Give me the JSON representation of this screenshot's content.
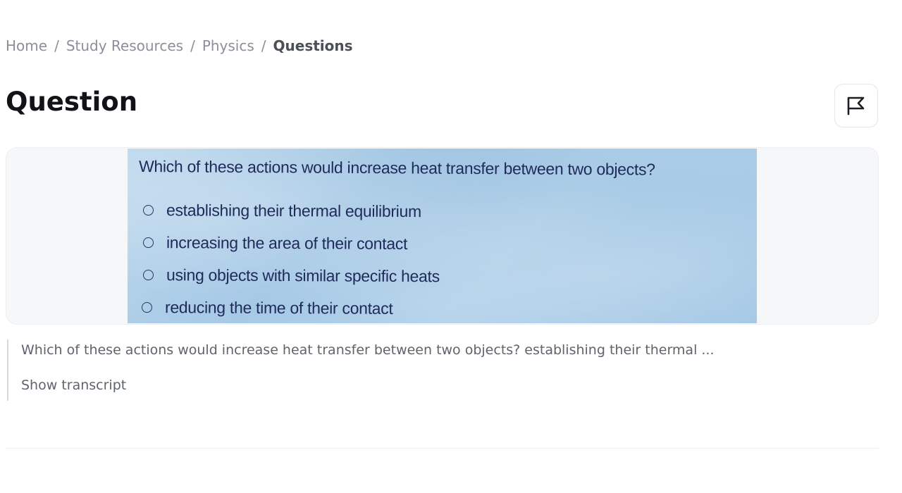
{
  "breadcrumb": {
    "items": [
      "Home",
      "Study Resources",
      "Physics"
    ],
    "current": "Questions",
    "separator": "/"
  },
  "page": {
    "title": "Question",
    "flag_icon": "flag-icon"
  },
  "question": {
    "text": "Which of these actions would increase heat transfer between two objects?",
    "options": [
      "establishing their thermal equilibrium",
      "increasing the area of their contact",
      "using objects with similar specific heats",
      "reducing the time of their contact"
    ]
  },
  "transcript": {
    "preview": "Which of these actions would increase heat transfer between two objects? establishing their thermal ...",
    "show_label": "Show transcript"
  },
  "colors": {
    "title": "#111318",
    "muted_text": "#8b8f99",
    "card_bg": "#f6f7f9",
    "image_ink": "#1f2a5a"
  }
}
